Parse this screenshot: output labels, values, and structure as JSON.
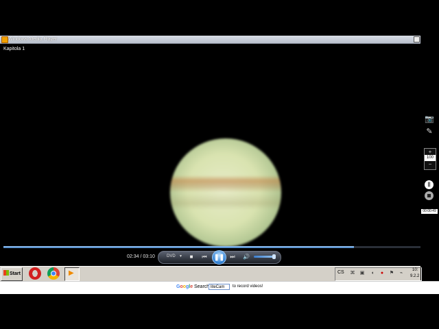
{
  "window": {
    "title": "Windows Media Player"
  },
  "video": {
    "chapter_label": "Kapitola 1"
  },
  "recorder": {
    "zoom_plus": "+",
    "zoom_value": "100",
    "zoom_minus": "−",
    "elapsed": "00:00:49"
  },
  "player": {
    "current_time": "02:34",
    "total_time": "03:10",
    "time_separator": "/",
    "source_label": "DVD",
    "progress_fraction": 0.84,
    "volume_fraction": 0.85
  },
  "taskbar": {
    "start_label": "Start",
    "language": "CS",
    "clock_time": "10:",
    "clock_date": "9.2.2"
  },
  "ad": {
    "google": [
      "G",
      "o",
      "o",
      "g",
      "l",
      "e"
    ],
    "search_label": "Search",
    "input_value": "liteCam",
    "text": "to record videos!"
  },
  "icons": [
    "app-icon",
    "camera-icon",
    "pencil-icon",
    "pause-record-icon",
    "stop-record-icon",
    "stop-icon",
    "previous-icon",
    "pause-icon",
    "next-icon",
    "volume-icon",
    "opera-icon",
    "chrome-icon",
    "media-player-icon",
    "windows-flag-icon"
  ]
}
